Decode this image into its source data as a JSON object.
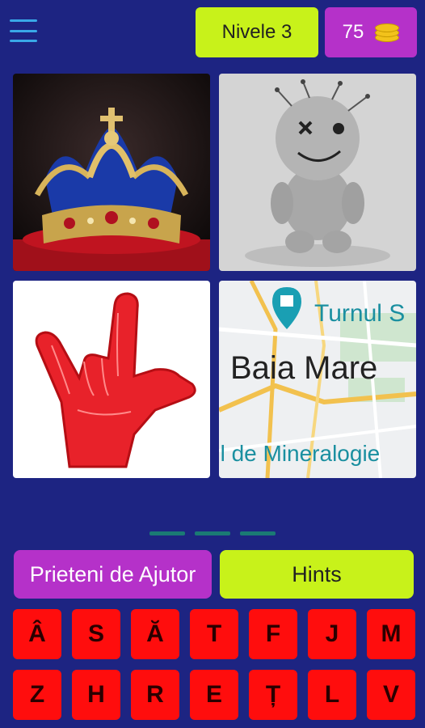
{
  "header": {
    "menu_icon": "hamburger-menu-icon",
    "level_label": "Nivele 3",
    "coins_value": "75",
    "coins_icon": "coin-stack-icon"
  },
  "images": [
    {
      "name": "crown-image"
    },
    {
      "name": "voodoo-doll-image"
    },
    {
      "name": "rock-hand-foam-finger-image"
    },
    {
      "name": "map-image",
      "poi_label": "Turnul S",
      "city_label": "Baia Mare",
      "museum_label": "ul de Mineralogie"
    }
  ],
  "answer_slots_count": 3,
  "buttons": {
    "friends": "Prieteni de Ajutor",
    "hints": "Hints"
  },
  "letters": [
    "Â",
    "S",
    "Ă",
    "T",
    "F",
    "J",
    "M",
    "Z",
    "H",
    "R",
    "E",
    "Ț",
    "L",
    "V"
  ],
  "colors": {
    "background": "#1d2482",
    "lime": "#c8f21a",
    "purple": "#b531c9",
    "letter_red": "#ff0d0d"
  }
}
